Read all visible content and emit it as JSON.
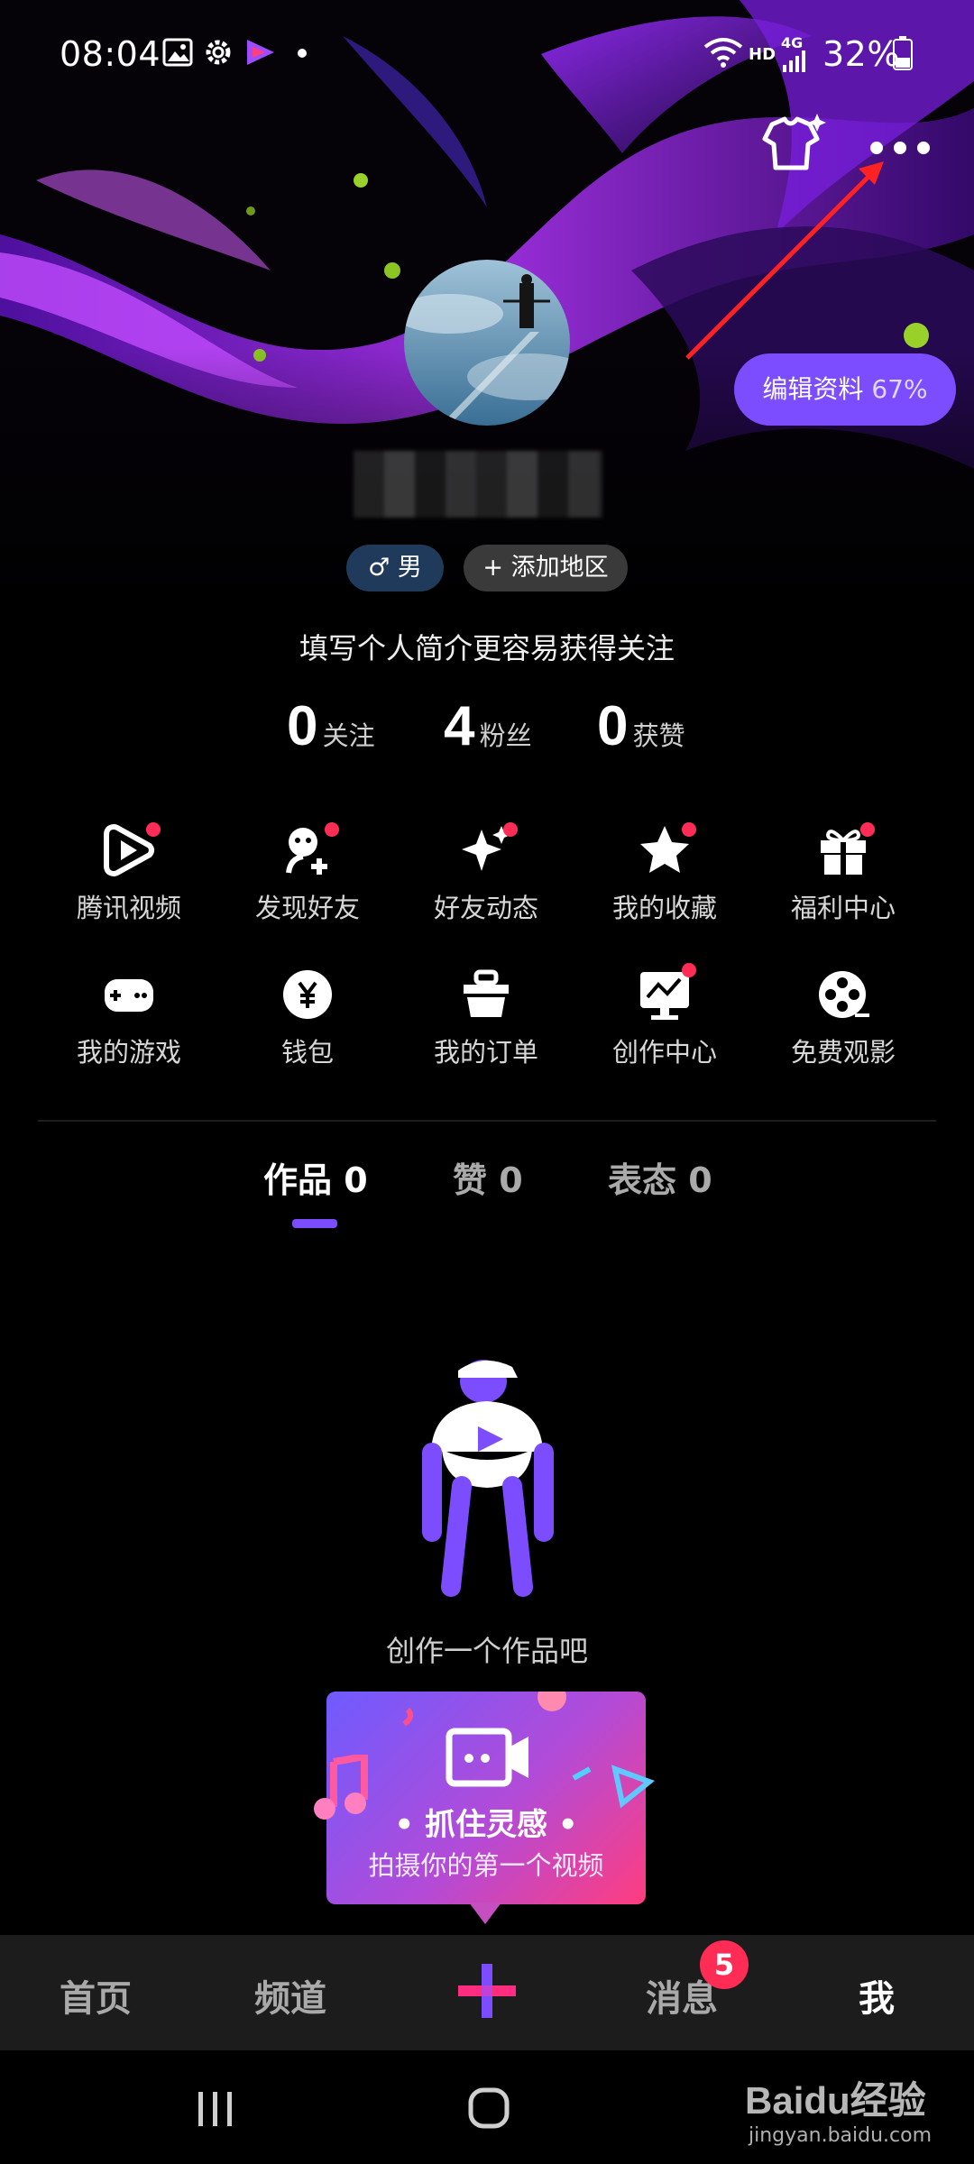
{
  "status_bar": {
    "time": "08:04",
    "network": "HD",
    "signal": "4G",
    "battery": "32%"
  },
  "profile": {
    "edit_label": "编辑资料",
    "edit_progress": "67%",
    "gender": "男",
    "add_region": "添加地区",
    "bio_prompt": "填写个人简介更容易获得关注"
  },
  "stats": [
    {
      "value": "0",
      "label": "关注"
    },
    {
      "value": "4",
      "label": "粉丝"
    },
    {
      "value": "0",
      "label": "获赞"
    }
  ],
  "shortcuts": [
    {
      "label": "腾讯视频",
      "icon": "tencent-video-icon",
      "badge": true
    },
    {
      "label": "发现好友",
      "icon": "discover-friends-icon",
      "badge": true
    },
    {
      "label": "好友动态",
      "icon": "sparkle-icon",
      "badge": true
    },
    {
      "label": "我的收藏",
      "icon": "star-icon",
      "badge": true
    },
    {
      "label": "福利中心",
      "icon": "gift-icon",
      "badge": true
    },
    {
      "label": "我的游戏",
      "icon": "gamepad-icon",
      "badge": false
    },
    {
      "label": "钱包",
      "icon": "wallet-icon",
      "badge": false
    },
    {
      "label": "我的订单",
      "icon": "basket-icon",
      "badge": false
    },
    {
      "label": "创作中心",
      "icon": "monitor-chart-icon",
      "badge": true
    },
    {
      "label": "免费观影",
      "icon": "film-reel-icon",
      "badge": false
    }
  ],
  "tabs": [
    {
      "label": "作品 0",
      "active": true
    },
    {
      "label": "赞 0",
      "active": false
    },
    {
      "label": "表态 0",
      "active": false
    }
  ],
  "empty_state": {
    "text": "创作一个作品吧"
  },
  "promo": {
    "title": "• 抓住灵感 •",
    "subtitle": "拍摄你的第一个视频"
  },
  "bottom_nav": [
    {
      "label": "首页",
      "active": false
    },
    {
      "label": "频道",
      "active": false
    },
    {
      "label": "+",
      "active": false
    },
    {
      "label": "消息",
      "active": false,
      "badge": "5"
    },
    {
      "label": "我",
      "active": true
    }
  ],
  "watermark": {
    "brand": "Baidu经验",
    "url": "jingyan.baidu.com"
  },
  "colors": {
    "accent": "#7b4dff",
    "badge": "#ff2d55",
    "promo_start": "#6f5bff",
    "promo_end": "#ff3d7f"
  }
}
